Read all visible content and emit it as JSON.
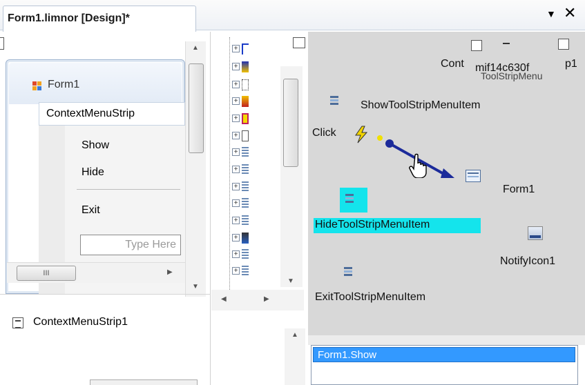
{
  "tab": {
    "title": "Form1.limnor [Design]*"
  },
  "form": {
    "title": "Form1",
    "menu_strip_label": "ContextMenuStrip",
    "menu_items": [
      "Show",
      "Hide",
      "Exit"
    ],
    "type_here": "Type Here",
    "hscroll_grip": "III"
  },
  "tray": {
    "component": "ContextMenuStrip1"
  },
  "map": {
    "show_item": "ShowToolStripMenuItem",
    "click_event": "Click",
    "form_target": "Form1",
    "hide_item": "HideToolStripMenuItem",
    "notify_icon": "NotifyIcon1",
    "exit_item": "ExitToolStripMenuItem",
    "overlap_cont": "Cont",
    "overlap_mif": "mif14c630f",
    "overlap_p1": "p1",
    "overlap_toolstrip": "ToolStripMenu"
  },
  "actions": {
    "selected": "Form1.Show"
  },
  "colors": {
    "highlight": "#14e4ec",
    "selection": "#3399ff",
    "arrow": "#1b2a9a"
  },
  "icons": [
    "dropdown-arrow-icon",
    "close-icon",
    "form-icon",
    "menu-item-icon",
    "event-lightning-icon",
    "hand-cursor-icon",
    "notify-icon-icon",
    "context-menu-icon"
  ]
}
